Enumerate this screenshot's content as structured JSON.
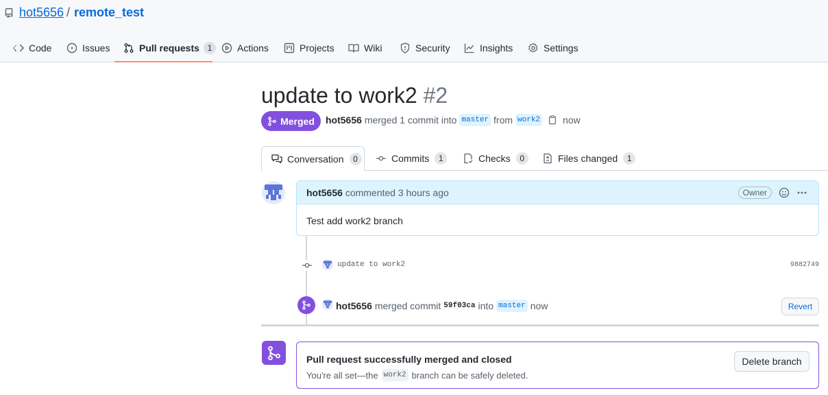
{
  "repo": {
    "owner": "hot5656",
    "separator": "/",
    "name": "remote_test"
  },
  "nav_tabs": [
    {
      "label": "Code",
      "icon": "code-icon"
    },
    {
      "label": "Issues",
      "icon": "issue-icon"
    },
    {
      "label": "Pull requests",
      "icon": "pull-request-icon",
      "count": "1",
      "selected": true
    },
    {
      "label": "Actions",
      "icon": "play-icon"
    },
    {
      "label": "Projects",
      "icon": "project-icon"
    },
    {
      "label": "Wiki",
      "icon": "book-icon"
    },
    {
      "label": "Security",
      "icon": "shield-icon"
    },
    {
      "label": "Insights",
      "icon": "graph-icon"
    },
    {
      "label": "Settings",
      "icon": "gear-icon"
    }
  ],
  "pr": {
    "title": "update to work2",
    "number": "#2",
    "state": "Merged",
    "author": "hot5656",
    "meta_text_1": "merged 1 commit into",
    "base_branch": "master",
    "meta_text_2": "from",
    "head_branch": "work2",
    "time": "now"
  },
  "pr_tabs": [
    {
      "label": "Conversation",
      "count": "0",
      "icon": "comment-discussion-icon",
      "selected": true
    },
    {
      "label": "Commits",
      "count": "1",
      "icon": "commit-icon"
    },
    {
      "label": "Checks",
      "count": "0",
      "icon": "checklist-icon"
    },
    {
      "label": "Files changed",
      "count": "1",
      "icon": "file-diff-icon"
    }
  ],
  "comment": {
    "author": "hot5656",
    "action": "commented 3 hours ago",
    "badge": "Owner",
    "body": "Test add work2 branch"
  },
  "commit": {
    "message": "update to work2",
    "sha": "9882749"
  },
  "merge_event": {
    "author": "hot5656",
    "text_1": "merged commit",
    "sha": "59f03ca",
    "text_2": "into",
    "branch": "master",
    "time": "now",
    "revert_label": "Revert"
  },
  "merge_box": {
    "title": "Pull request successfully merged and closed",
    "desc_1": "You're all set—the",
    "branch": "work2",
    "desc_2": "branch can be safely deleted.",
    "delete_label": "Delete branch"
  },
  "colors": {
    "merged_purple": "#8250df",
    "link_blue": "#0969da",
    "tab_underline": "#fd8c73"
  }
}
